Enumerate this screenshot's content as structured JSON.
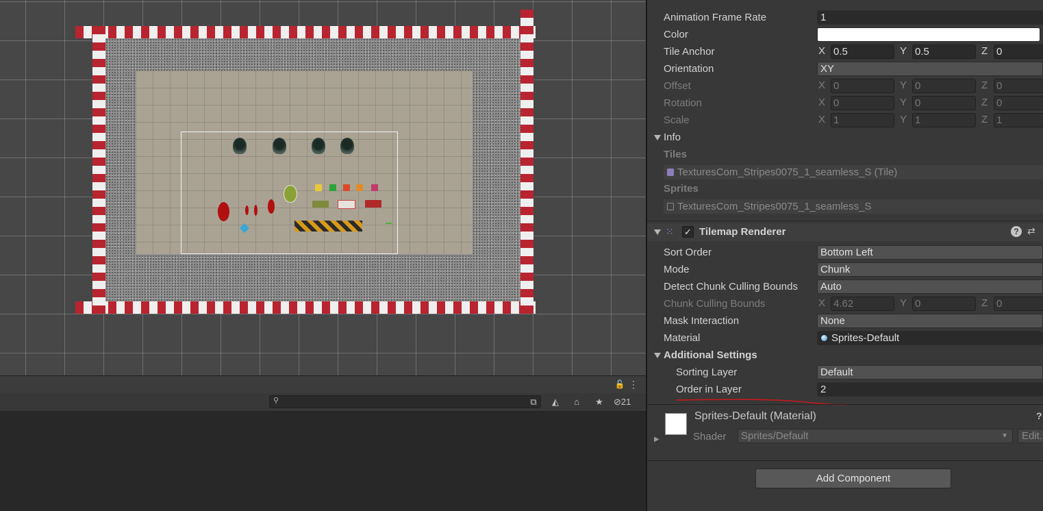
{
  "scene": {
    "title": ""
  },
  "bottom": {
    "hidden_count": "21",
    "search": {
      "placeholder": ""
    }
  },
  "inspector": {
    "tilemap_rows": [
      {
        "label": "Animation Frame Rate",
        "value": "1"
      },
      {
        "label": "Color",
        "value": ""
      },
      {
        "label": "Tile Anchor",
        "x": "0.5",
        "y": "0.5",
        "z": "0"
      },
      {
        "label": "Orientation",
        "value": "XY"
      },
      {
        "label": "Offset",
        "x": "0",
        "y": "0",
        "z": "0"
      },
      {
        "label": "Rotation",
        "x": "0",
        "y": "0",
        "z": "0"
      },
      {
        "label": "Scale",
        "x": "1",
        "y": "1",
        "z": "1"
      }
    ],
    "axis": {
      "x": "X",
      "y": "Y",
      "z": "Z"
    },
    "info": {
      "label": "Info",
      "tiles_label": "Tiles",
      "tile_item": "TexturesCom_Stripes0075_1_seamless_S (Tile)",
      "sprites_label": "Sprites",
      "sprite_item": "TexturesCom_Stripes0075_1_seamless_S"
    },
    "renderer": {
      "title": "Tilemap Renderer",
      "enabled": true,
      "sort_order": {
        "label": "Sort Order",
        "value": "Bottom Left"
      },
      "mode": {
        "label": "Mode",
        "value": "Chunk"
      },
      "detect_bounds": {
        "label": "Detect Chunk Culling Bounds",
        "value": "Auto"
      },
      "culling_bounds": {
        "label": "Chunk Culling Bounds",
        "x": "4.62",
        "y": "0",
        "z": "0"
      },
      "mask": {
        "label": "Mask Interaction",
        "value": "None"
      },
      "material": {
        "label": "Material",
        "value": "Sprites-Default"
      },
      "additional": {
        "label": "Additional Settings"
      },
      "sorting_layer": {
        "label": "Sorting Layer",
        "value": "Default"
      },
      "order_in_layer": {
        "label": "Order in Layer",
        "value": "2"
      }
    },
    "material_section": {
      "title": "Sprites-Default (Material)",
      "shader_label": "Shader",
      "shader_value": "Sprites/Default",
      "edit_label": "Edit..."
    },
    "add_component": "Add Component"
  },
  "colors": {
    "accent_underline": "#c8191e",
    "stripe_red": "#b8242f"
  }
}
